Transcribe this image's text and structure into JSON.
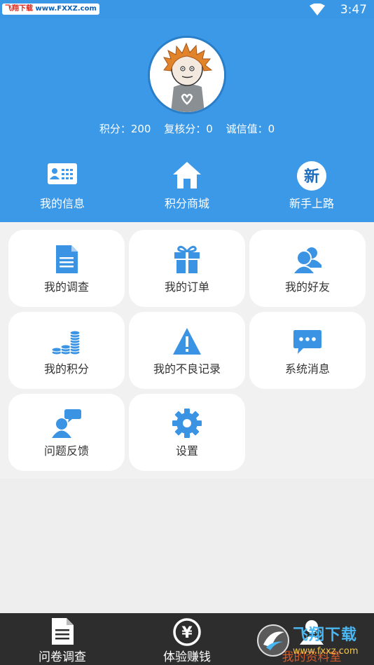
{
  "status_bar": {
    "watermark_left": {
      "brand": "飞翔下载",
      "url": "www.FXXZ.com"
    },
    "time": "3:47"
  },
  "profile": {
    "scores": {
      "points": "积分：200",
      "review_points": "复核分：0",
      "credit": "诚信值：0"
    }
  },
  "quick_actions": [
    {
      "label": "我的信息",
      "icon": "id-card-icon"
    },
    {
      "label": "积分商城",
      "icon": "home-icon"
    },
    {
      "label": "新手上路",
      "icon": "new-badge-icon",
      "icon_text": "新"
    }
  ],
  "menu": [
    {
      "label": "我的调查",
      "icon": "document-icon"
    },
    {
      "label": "我的订单",
      "icon": "gift-icon"
    },
    {
      "label": "我的好友",
      "icon": "friends-icon"
    },
    {
      "label": "我的积分",
      "icon": "coins-icon"
    },
    {
      "label": "我的不良记录",
      "icon": "warning-icon"
    },
    {
      "label": "系统消息",
      "icon": "message-icon"
    },
    {
      "label": "问题反馈",
      "icon": "feedback-icon"
    },
    {
      "label": "设置",
      "icon": "gear-icon"
    }
  ],
  "tab_bar": {
    "tabs": [
      {
        "label": "问卷调查",
        "icon": "document-icon"
      },
      {
        "label": "体验赚钱",
        "icon": "yen-icon",
        "icon_text": "¥"
      },
      {
        "label": "我的资料室",
        "icon": "profile-icon"
      }
    ]
  },
  "watermark_logo": {
    "title": "飞翔下载",
    "url": "www.fxxz.com"
  },
  "colors": {
    "primary": "#3b99e8",
    "icon_blue": "#3a93e3",
    "tab_bar": "#2d2d2d",
    "grid_bg": "#f2f1f1"
  }
}
